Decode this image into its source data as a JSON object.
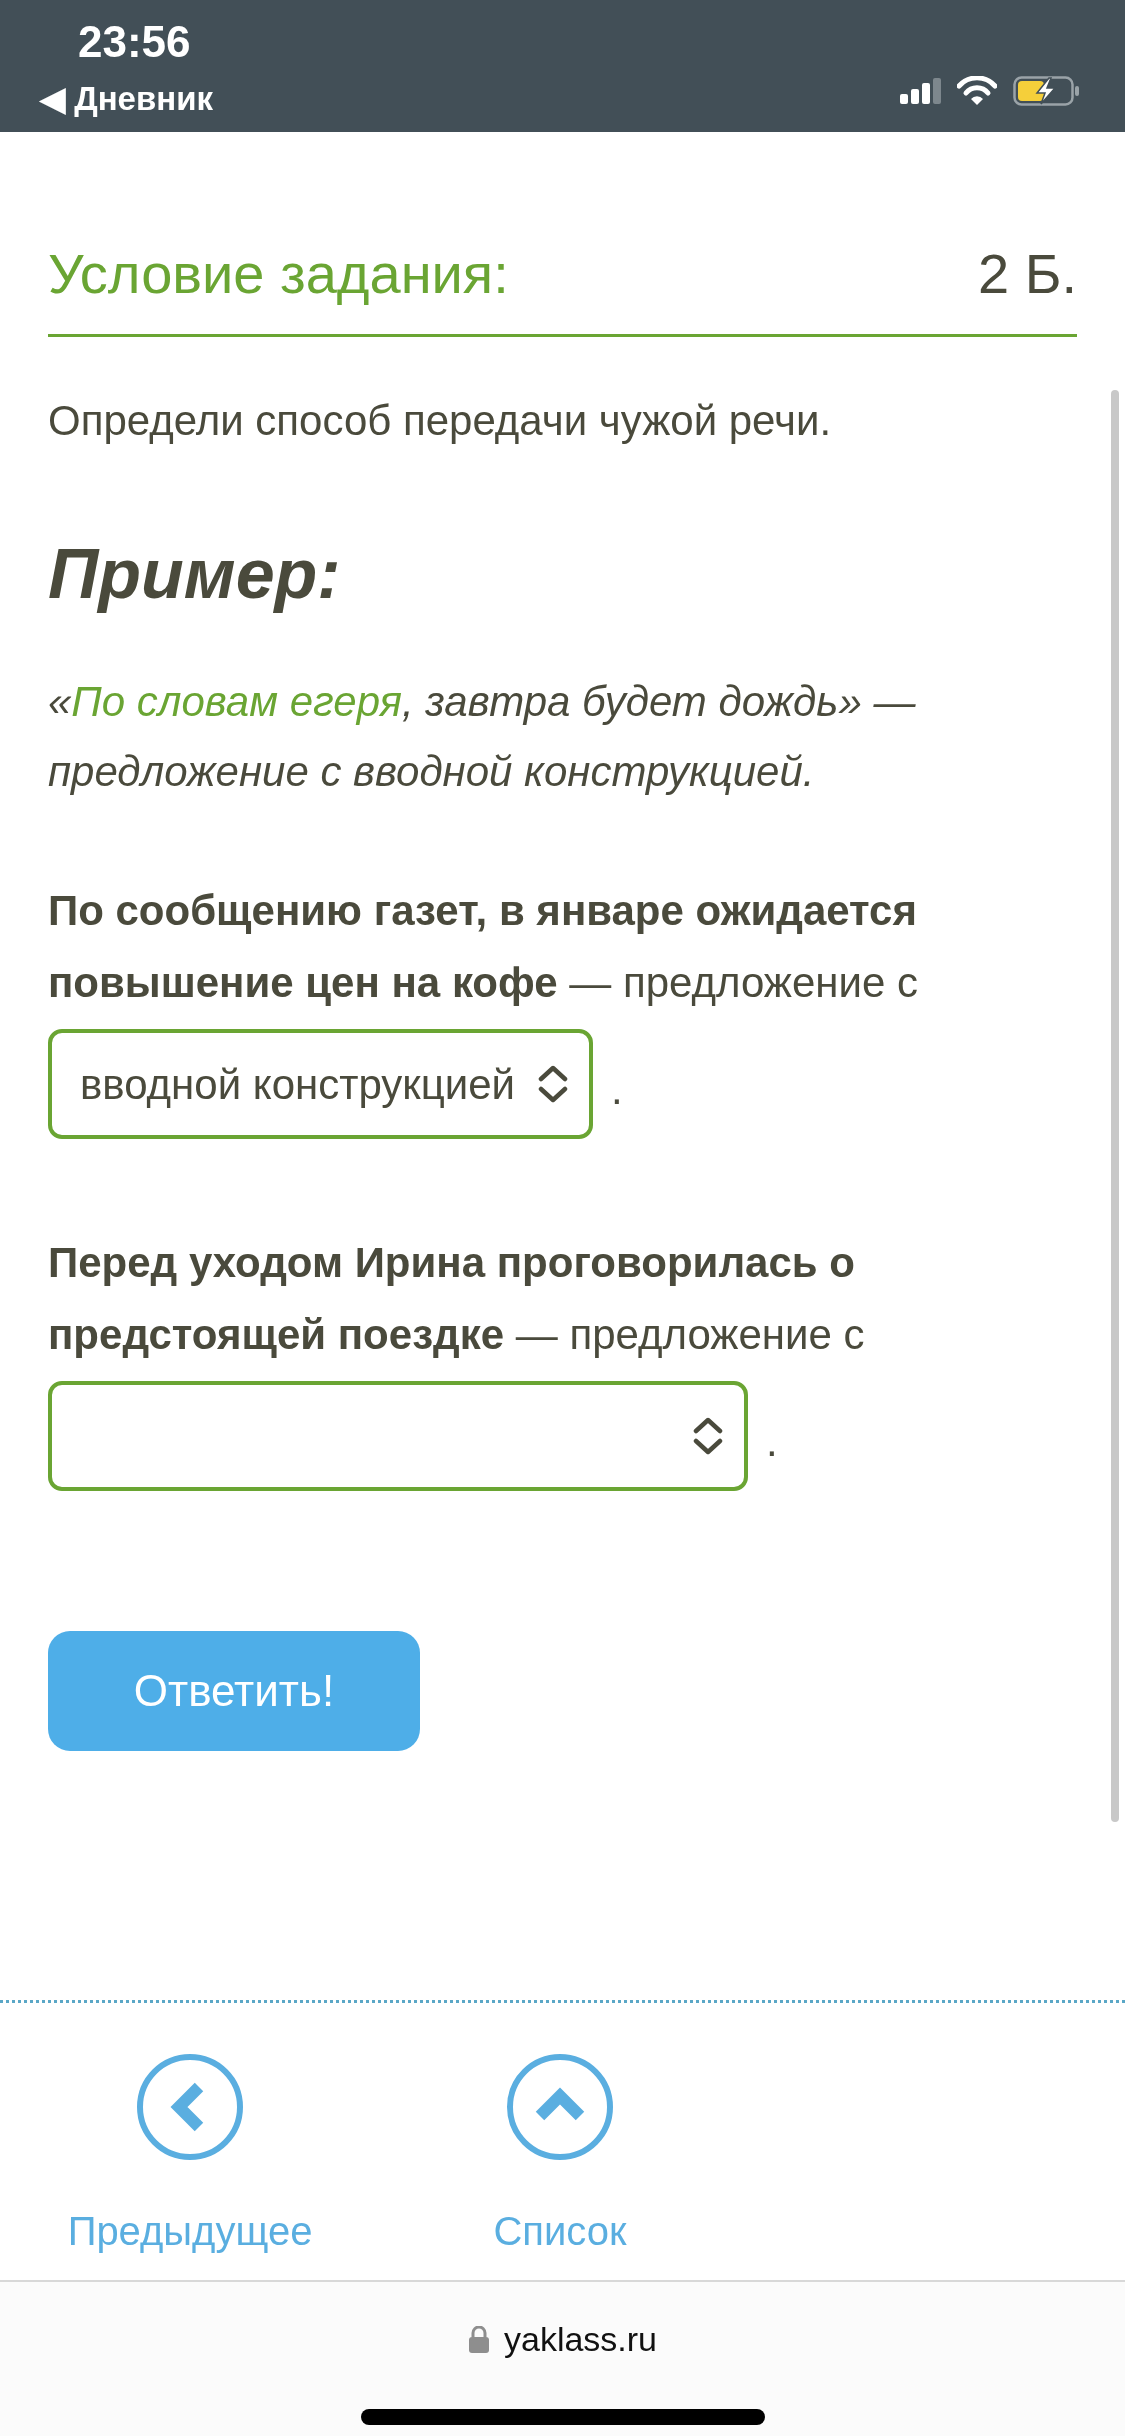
{
  "status_bar": {
    "time": "23:56",
    "back": "◀ Дневник"
  },
  "task": {
    "title": "Условие задания:",
    "points": "2 Б.",
    "instruction": "Определи способ передачи чужой речи.",
    "example_heading": "Пример:",
    "example": {
      "quote_open": "«",
      "highlight": "По словам егеря",
      "rest": ", завтра будет дождь» — предложение с вводной конструкцией."
    },
    "questions": [
      {
        "text": "**По сообщению газет, в январе ожидается повышение цен на кофе** — предложение с",
        "value": "вводной конструкцией",
        "end": "."
      },
      {
        "text": "**Перед уходом Ирина проговорилась о предстоящей поездке** — предложение с",
        "end": "."
      }
    ],
    "submit": "Ответить!"
  },
  "nav": [
    {
      "kind": "prev",
      "label": "Предыдущее"
    },
    {
      "kind": "list",
      "label": "Список"
    }
  ],
  "browser": {
    "url": "yaklass.ru"
  }
}
